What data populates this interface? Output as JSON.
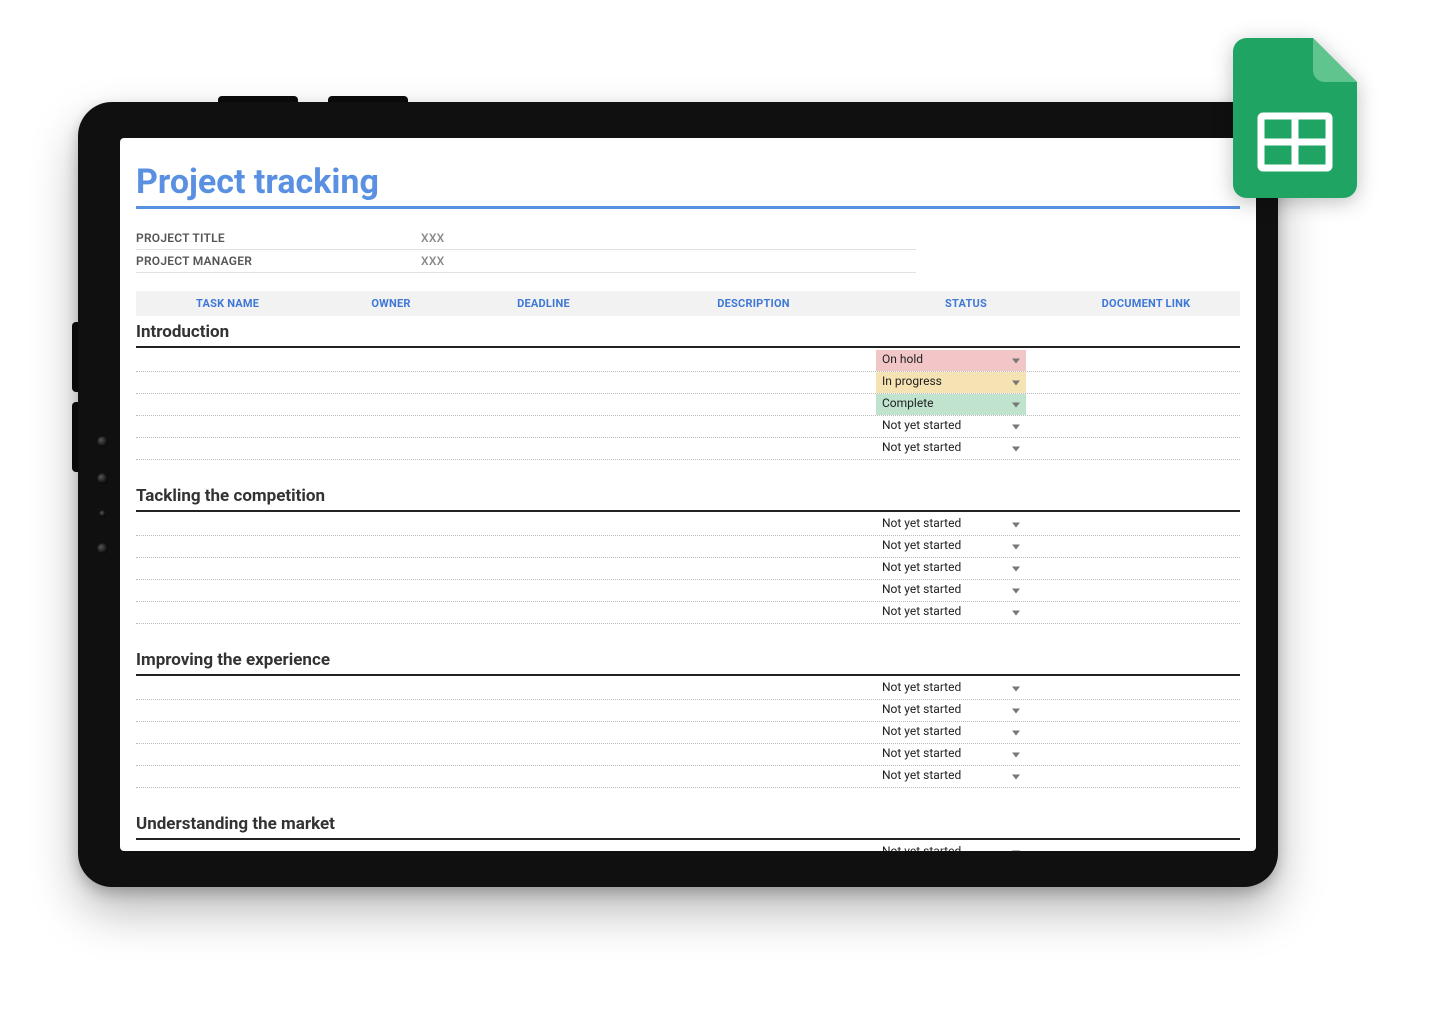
{
  "title": "Project tracking",
  "meta": {
    "project_title_label": "PROJECT TITLE",
    "project_title_value": "XXX",
    "project_manager_label": "PROJECT MANAGER",
    "project_manager_value": "XXX"
  },
  "columns": {
    "task": "TASK NAME",
    "owner": "OWNER",
    "deadline": "DEADLINE",
    "description": "DESCRIPTION",
    "status": "STATUS",
    "link": "DOCUMENT LINK"
  },
  "status_labels": {
    "on_hold": "On hold",
    "in_progress": "In progress",
    "complete": "Complete",
    "not_started": "Not yet started"
  },
  "status_colors": {
    "on_hold": "#f2c6c6",
    "in_progress": "#f6e3b3",
    "complete": "#bfe3cd",
    "not_started": "transparent"
  },
  "sections": [
    {
      "title": "Introduction",
      "rows": [
        {
          "status_key": "on_hold"
        },
        {
          "status_key": "in_progress"
        },
        {
          "status_key": "complete"
        },
        {
          "status_key": "not_started"
        },
        {
          "status_key": "not_started"
        }
      ]
    },
    {
      "title": "Tackling the competition",
      "rows": [
        {
          "status_key": "not_started"
        },
        {
          "status_key": "not_started"
        },
        {
          "status_key": "not_started"
        },
        {
          "status_key": "not_started"
        },
        {
          "status_key": "not_started"
        }
      ]
    },
    {
      "title": "Improving the experience",
      "rows": [
        {
          "status_key": "not_started"
        },
        {
          "status_key": "not_started"
        },
        {
          "status_key": "not_started"
        },
        {
          "status_key": "not_started"
        },
        {
          "status_key": "not_started"
        }
      ]
    },
    {
      "title": "Understanding the market",
      "rows": [
        {
          "status_key": "not_started"
        },
        {
          "status_key": "not_started"
        }
      ]
    }
  ],
  "badge": {
    "brand": "google-sheets",
    "fill": "#1fa463",
    "fold": "#5fc48d"
  }
}
